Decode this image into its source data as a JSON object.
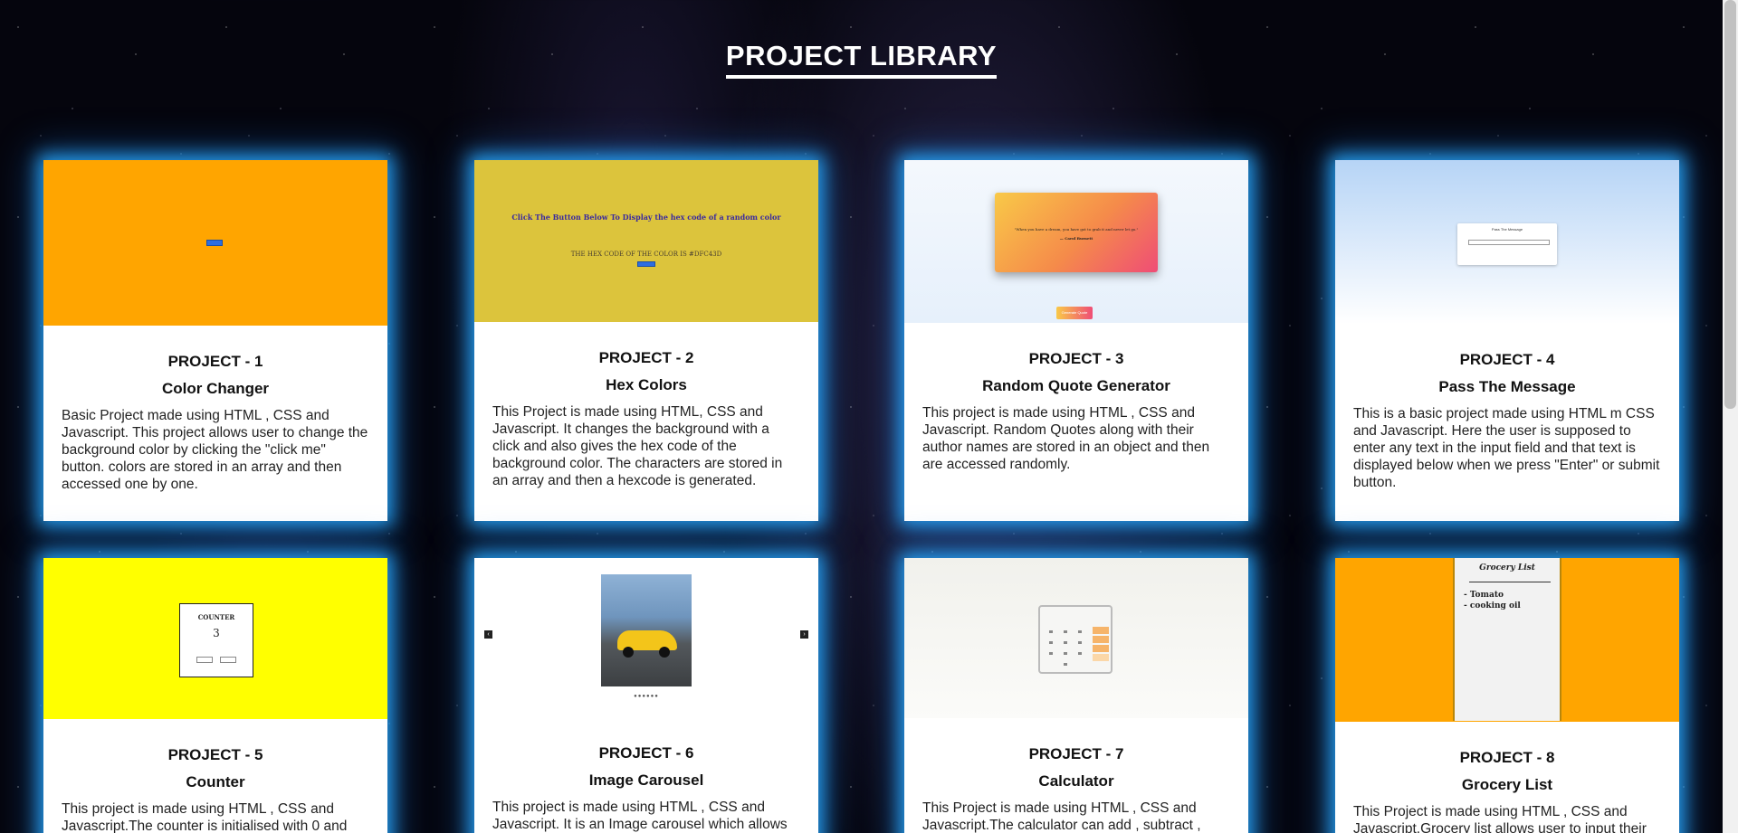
{
  "page": {
    "title": "PROJECT LIBRARY"
  },
  "projects": [
    {
      "number": "PROJECT - 1",
      "name": "Color Changer",
      "description": "Basic Project made using HTML , CSS and Javascript. This project allows user to change the background color by clicking the \"click me\" button. colors are stored in an array and then accessed one by one.",
      "thumb_bg": "#ffa500"
    },
    {
      "number": "PROJECT - 2",
      "name": "Hex Colors",
      "description": "This Project is made using HTML, CSS and Javascript. It changes the background with a click and also gives the hex code of the background color. The characters are stored in an array and then a hexcode is generated.",
      "thumb_bg": "#dcc43c",
      "thumb_heading": "Click The Button Below To Display the hex code of a random color",
      "thumb_code": "THE HEX CODE OF THE COLOR IS #DFC43D"
    },
    {
      "number": "PROJECT - 3",
      "name": "Random Quote Generator",
      "description": "This project is made using HTML , CSS and Javascript. Random Quotes along with their author names are stored in an object and then are accessed randomly.",
      "thumb_bg": "#eef4fb",
      "thumb_quote": "\"When you have a dream, you have got to grab it and never let go.\"",
      "thumb_author": "— Carol Burnett",
      "thumb_button": "Generate Quote"
    },
    {
      "number": "PROJECT - 4",
      "name": "Pass The Message",
      "description": "This is a basic project made using HTML m CSS and Javascript. Here the user is supposed to enter any text in the input field and that text is displayed below when we press \"Enter\" or submit button.",
      "thumb_bg": "#b8d8f8",
      "thumb_title": "Pass The Message"
    },
    {
      "number": "PROJECT - 5",
      "name": "Counter",
      "description": "This project is made using HTML , CSS and Javascript.The counter is initialised with 0 and",
      "thumb_bg": "#ffff00",
      "thumb_label": "COUNTER",
      "thumb_value": "3"
    },
    {
      "number": "PROJECT - 6",
      "name": "Image Carousel",
      "description": "This project is made using HTML , CSS and Javascript. It is an Image carousel which allows",
      "thumb_bg": "#ffffff"
    },
    {
      "number": "PROJECT - 7",
      "name": "Calculator",
      "description": "This Project is made using HTML , CSS and Javascript.The calculator can add , subtract ,",
      "thumb_bg": "#f3f3ef"
    },
    {
      "number": "PROJECT - 8",
      "name": "Grocery List",
      "description": "This Project is made using HTML , CSS and Javascript.Grocery list allows user to input their",
      "thumb_bg": "#ffa500",
      "thumb_title": "Grocery List",
      "thumb_items": [
        "- Tomato",
        "- cooking oil"
      ]
    }
  ],
  "colors": {
    "glow": "#28aaff",
    "background": "#05050d"
  }
}
